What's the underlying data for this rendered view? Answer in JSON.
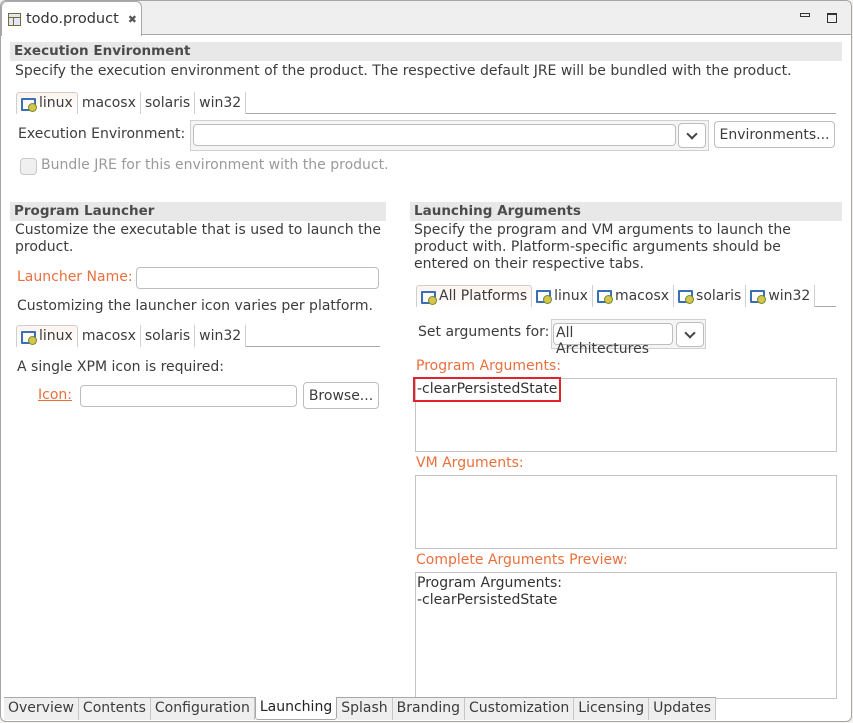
{
  "editor": {
    "tab_title": "todo.product",
    "icons": {
      "tab": "product-file-icon",
      "close": "close-icon",
      "minimize": "minimize-icon",
      "maximize": "maximize-icon"
    }
  },
  "execution_environment": {
    "title": "Execution Environment",
    "description": "Specify the execution environment of the product. The respective default JRE will be bundled with the product.",
    "tabs": [
      "linux",
      "macosx",
      "solaris",
      "win32"
    ],
    "active_tab": "linux",
    "field_label": "Execution Environment:",
    "field_value": "",
    "environments_button": "Environments...",
    "bundle_jre_label": "Bundle JRE for this environment with the product.",
    "bundle_jre_checked": false
  },
  "program_launcher": {
    "title": "Program Launcher",
    "description": "Customize the executable that is used to launch the product.",
    "launcher_name_label": "Launcher Name:",
    "launcher_name_value": "",
    "icon_note": "Customizing the launcher icon varies per platform.",
    "tabs": [
      "linux",
      "macosx",
      "solaris",
      "win32"
    ],
    "active_tab": "linux",
    "xpm_note": "A single XPM icon is required:",
    "icon_label": "Icon:",
    "icon_value": "",
    "browse_button": "Browse..."
  },
  "launching_arguments": {
    "title": "Launching Arguments",
    "description": "Specify the program and VM arguments to launch the product with.  Platform-specific arguments should be entered on their respective tabs.",
    "tabs": [
      "All Platforms",
      "linux",
      "macosx",
      "solaris",
      "win32"
    ],
    "active_tab": "All Platforms",
    "set_args_label": "Set arguments for:",
    "architecture_value": "All Architectures",
    "program_args_label": "Program Arguments:",
    "program_args_value": "-clearPersistedState",
    "vm_args_label": "VM Arguments:",
    "vm_args_value": "",
    "preview_label": "Complete Arguments Preview:",
    "preview_value": "Program Arguments:\n-clearPersistedState"
  },
  "bottom_tabs": [
    "Overview",
    "Contents",
    "Configuration",
    "Launching",
    "Splash",
    "Branding",
    "Customization",
    "Licensing",
    "Updates"
  ],
  "active_bottom_tab": "Launching",
  "colors": {
    "accent_label": "#e8703e",
    "highlight": "#e0242a"
  }
}
